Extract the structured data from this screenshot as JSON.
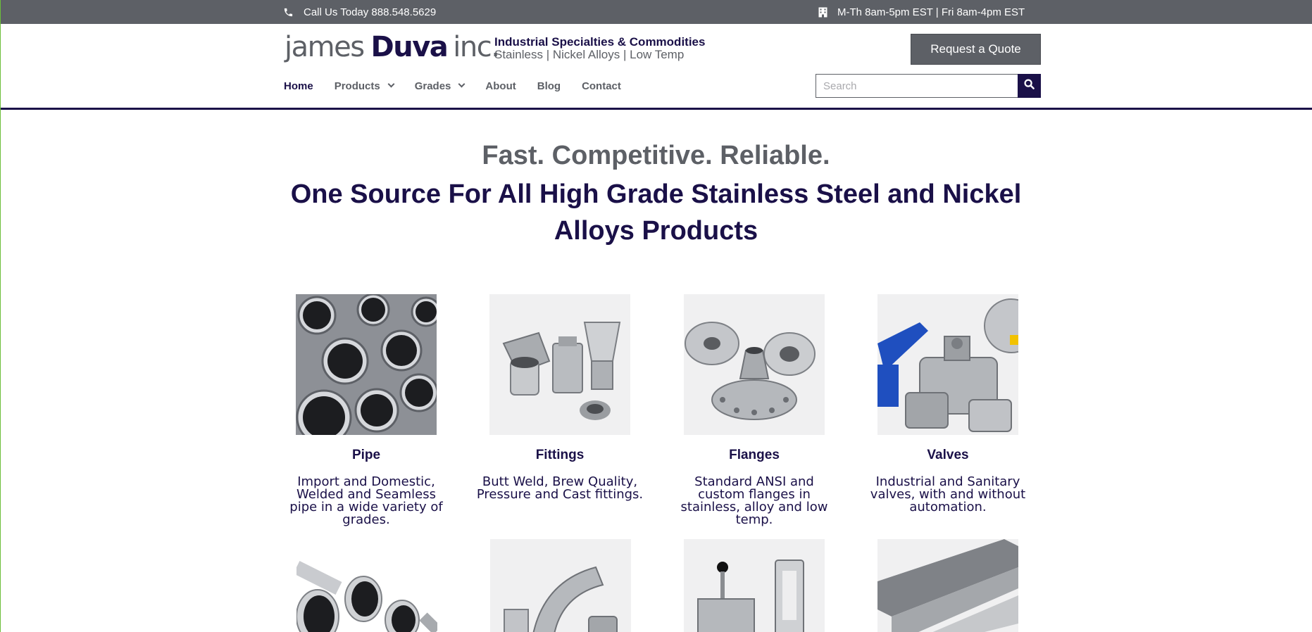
{
  "topbar": {
    "phone_text": "Call Us Today 888.548.5629",
    "hours_text": "M-Th 8am-5pm EST | Fri 8am-4pm EST"
  },
  "header": {
    "logo": {
      "part1": "james",
      "part2": "Duva",
      "part3": "inc."
    },
    "tagline_title": "Industrial Specialties & Commodities",
    "tagline_sub": "Stainless | Nickel Alloys | Low Temp",
    "quote_button": "Request a Quote",
    "search_placeholder": "Search"
  },
  "nav": {
    "items": [
      {
        "label": "Home",
        "active": true
      },
      {
        "label": "Products",
        "dropdown": true
      },
      {
        "label": "Grades",
        "dropdown": true
      },
      {
        "label": "About"
      },
      {
        "label": "Blog"
      },
      {
        "label": "Contact"
      }
    ]
  },
  "hero": {
    "line1": "Fast. Competitive. Reliable.",
    "line2": "One Source For All High Grade Stainless Steel and Nickel Alloys Products"
  },
  "products": [
    {
      "title": "Pipe",
      "desc": "Import and Domestic, Welded and Seamless pipe in a wide variety of grades.",
      "image": "pipe-bundle-image"
    },
    {
      "title": "Fittings",
      "desc": "Butt Weld, Brew Quality, Pressure and Cast fittings.",
      "image": "fittings-image"
    },
    {
      "title": "Flanges",
      "desc": "Standard ANSI and custom flanges in stainless, alloy and low temp.",
      "image": "flanges-image"
    },
    {
      "title": "Valves",
      "desc": "Industrial and Sanitary valves, with and without automation.",
      "image": "valves-image"
    }
  ],
  "colors": {
    "brand_navy": "#1a1048",
    "brand_gray": "#5d6066",
    "accent_yellow": "#f2c200",
    "accent_blue": "#1f4fbf"
  }
}
